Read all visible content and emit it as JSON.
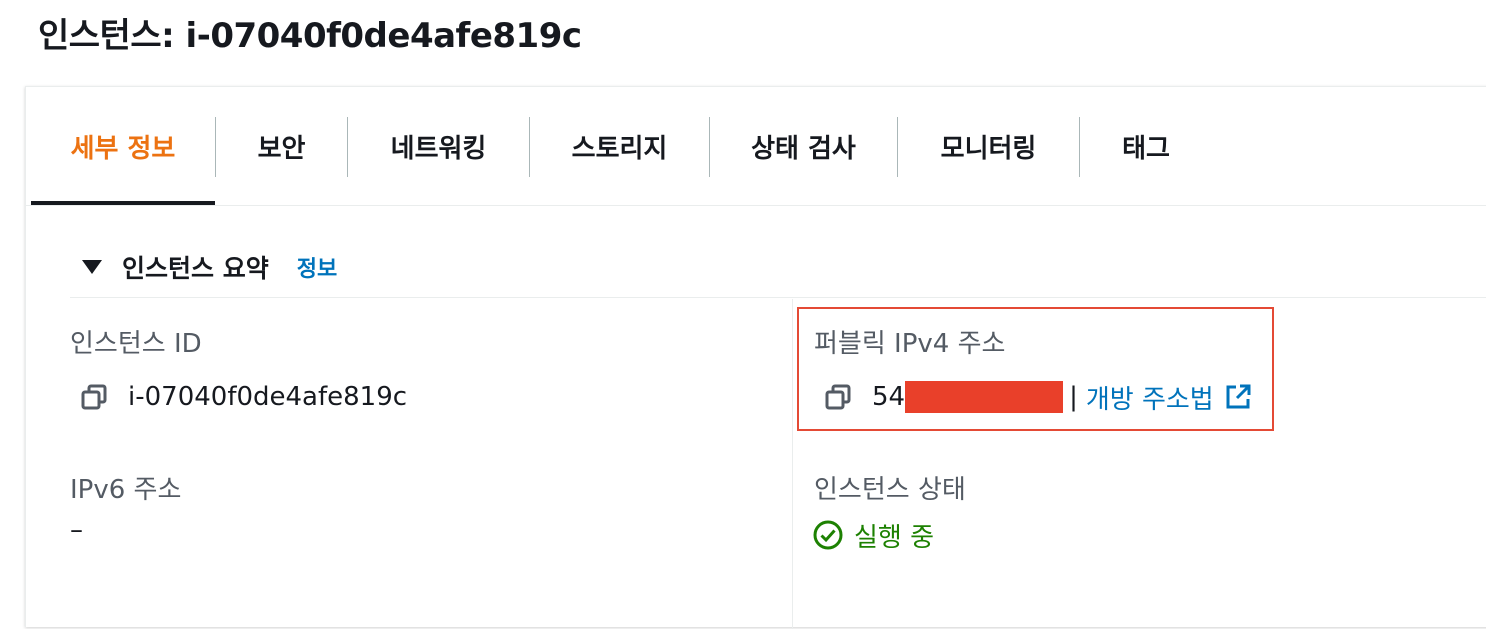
{
  "page": {
    "title": "인스턴스: i-07040f0de4afe819c"
  },
  "tabs": [
    {
      "label": "세부 정보",
      "active": true
    },
    {
      "label": "보안",
      "active": false
    },
    {
      "label": "네트워킹",
      "active": false
    },
    {
      "label": "스토리지",
      "active": false
    },
    {
      "label": "상태 검사",
      "active": false
    },
    {
      "label": "모니터링",
      "active": false
    },
    {
      "label": "태그",
      "active": false
    }
  ],
  "summary": {
    "title": "인스턴스 요약",
    "info_link": "정보",
    "instance_id": {
      "label": "인스턴스 ID",
      "value": "i-07040f0de4afe819c",
      "icon": "copy-icon"
    },
    "public_ipv4": {
      "label": "퍼블릭 IPv4 주소",
      "value_prefix": "54",
      "separator": "|",
      "link_label": "개방 주소법",
      "icon": "copy-icon",
      "link_icon": "external-link-icon"
    },
    "ipv6": {
      "label": "IPv6 주소",
      "value": "–"
    },
    "instance_state": {
      "label": "인스턴스 상태",
      "value": "실행 중",
      "icon": "check-circle-icon"
    }
  },
  "colors": {
    "accent": "#ec7211",
    "link": "#0073bb",
    "success": "#1d8102",
    "highlight": "#e44a35",
    "redaction": "#e9402a"
  }
}
